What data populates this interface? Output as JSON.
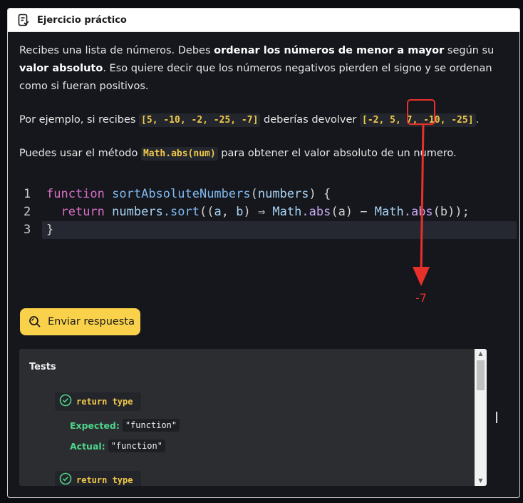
{
  "window": {
    "title": "Ejercicio práctico",
    "icon": "checklist-icon"
  },
  "description": {
    "p1_a": "Recibes una lista de números. Debes ",
    "p1_b": "ordenar los números de menor a mayor",
    "p1_c": " según su ",
    "p1_d": "valor absoluto",
    "p1_e": ". Eso quiere decir que los números negativos pierden el signo y se ordenan como si fueran positivos.",
    "p2_a": "Por ejemplo, si recibes ",
    "p2_code1": "[5, -10, -2, -25, -7]",
    "p2_b": " deberías devolver ",
    "p2_code2": "[-2, 5, 7, -10, -25]",
    "p2_c": ".",
    "p3_a": "Puedes usar el método ",
    "p3_code": "Math.abs(num)",
    "p3_b": " para obtener el valor absoluto de un numero."
  },
  "editor": {
    "lines": [
      {
        "num": "1"
      },
      {
        "num": "2"
      },
      {
        "num": "3"
      }
    ],
    "tokens": {
      "function_kw": "function",
      "fn_name": "sortAbsoluteNumbers",
      "open_paren": "(",
      "param": "numbers",
      "close_brace_open": ") {",
      "return_kw": "return",
      "obj": "numbers",
      "dot_sort": ".sort",
      "args_open": "((",
      "a": "a",
      "comma": ", ",
      "b": "b",
      "arrow": ") ⇒ ",
      "math1": "Math",
      "abs1": ".abs",
      "a_arg": "(a)",
      "minus": " − ",
      "math2": "Math",
      "abs2": ".abs",
      "b_arg": "(b)",
      "end": ");",
      "close_brace": "}"
    }
  },
  "annotation": {
    "label": "-7",
    "color": "#e8302a"
  },
  "send_button": {
    "label": "Enviar respuesta",
    "icon": "search-icon"
  },
  "tests": {
    "heading": "Tests",
    "cases": [
      {
        "name": "return type",
        "expected_label": "Expected:",
        "expected_value": "\"function\"",
        "actual_label": "Actual:",
        "actual_value": "\"function\""
      },
      {
        "name": "return type"
      }
    ]
  },
  "colors": {
    "accent": "#f9d14a",
    "pass": "#4fd48a",
    "code_yellow": "#f0c84a"
  }
}
